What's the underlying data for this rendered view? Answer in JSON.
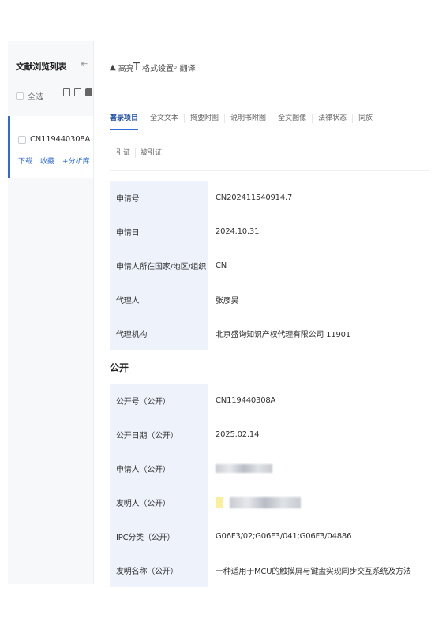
{
  "sidebar": {
    "title": "文献浏览列表",
    "collapse_icon": "collapse-icon",
    "select_all": "全选",
    "doc": {
      "id": "CN119440308A",
      "download": "下载",
      "favorite": "收藏",
      "add_to_library": "+分析库"
    }
  },
  "toolbar": {
    "highlight": "高亮",
    "format_settings": "格式设置",
    "translate": "翻译"
  },
  "tabs": [
    "著录项目",
    "全文文本",
    "摘要附图",
    "说明书附图",
    "全文图像",
    "法律状态",
    "同族"
  ],
  "subtabs": [
    "引证",
    "被引证"
  ],
  "application": [
    {
      "label": "申请号",
      "value": "CN202411540914.7"
    },
    {
      "label": "申请日",
      "value": "2024.10.31"
    },
    {
      "label": "申请人所在国家/地区/组织",
      "value": "CN"
    },
    {
      "label": "代理人",
      "value": "张彦昊"
    },
    {
      "label": "代理机构",
      "value": "北京盛询知识产权代理有限公司 11901"
    }
  ],
  "publication_section": "公开",
  "publication": [
    {
      "label": "公开号（公开）",
      "value": "CN119440308A"
    },
    {
      "label": "公开日期（公开）",
      "value": "2025.02.14"
    },
    {
      "label": "申请人（公开）",
      "value": ""
    },
    {
      "label": "发明人（公开）",
      "value": ""
    },
    {
      "label": "IPC分类（公开）",
      "value": "G06F3/02;G06F3/041;G06F3/04886"
    },
    {
      "label": "发明名称（公开）",
      "value": "一种适用于MCU的触摸屏与键盘实现同步交互系统及方法"
    }
  ],
  "colors": {
    "accent": "#2f6bd6",
    "label_bg": "#eef2fb"
  }
}
